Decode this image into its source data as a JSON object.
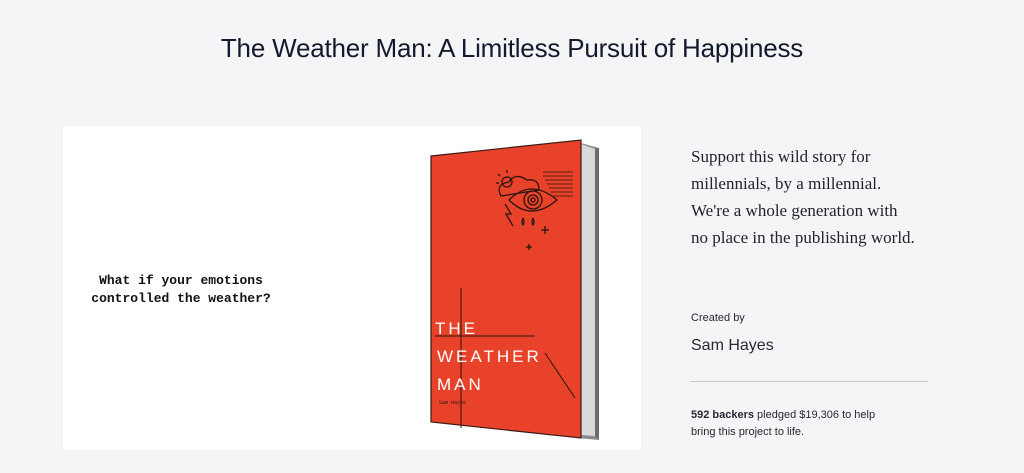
{
  "page": {
    "title": "The Weather Man: A Limitless Pursuit of Happiness"
  },
  "hero": {
    "tagline_line1": "What if your emotions",
    "tagline_line2": "controlled the weather?",
    "book_title_line1": "THE",
    "book_title_line2": "WEATHER",
    "book_title_line3": "MAN",
    "book_author": "Sam Hayes",
    "cover_color": "#e8432a"
  },
  "sidebar": {
    "blurb": "Support this wild story for millennials, by a millennial. We're a whole generation with no place in the publishing world.",
    "created_by_label": "Created by",
    "creator_name": "Sam Hayes",
    "backers_count": "592 backers",
    "pledged_text": " pledged $19,306 to help bring this project to life."
  }
}
